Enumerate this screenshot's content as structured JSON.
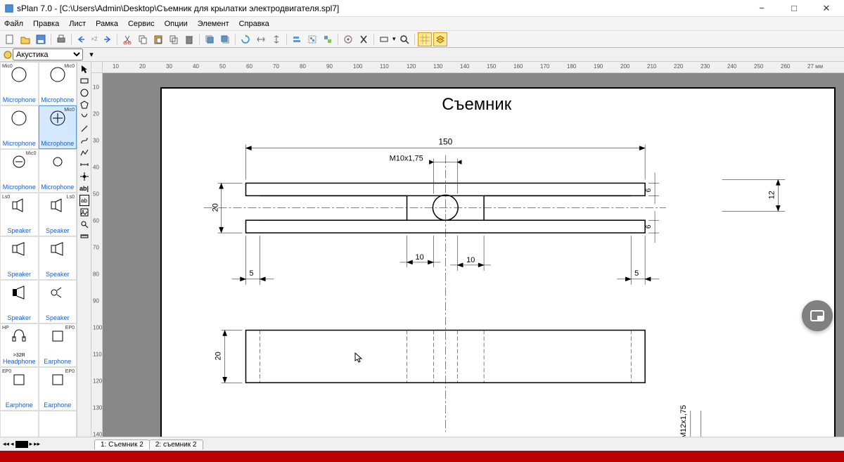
{
  "app": {
    "title": "sPlan 7.0 - [C:\\Users\\Admin\\Desktop\\Съемник для крылатки электродвигателя.spl7]"
  },
  "menu": [
    "Файл",
    "Правка",
    "Лист",
    "Рамка",
    "Сервис",
    "Опции",
    "Элемент",
    "Справка"
  ],
  "category": "Акустика",
  "palette": [
    {
      "l": "Microphone",
      "tag": "Mic0",
      "tl": "l"
    },
    {
      "l": "Microphone",
      "tag": "Mic0",
      "tl": "r"
    },
    {
      "l": "Microphone"
    },
    {
      "l": "Microphone",
      "tag": "Mic0",
      "tl": "r",
      "sel": true
    },
    {
      "l": "Microphone",
      "tag": "Mic0",
      "tl": "r"
    },
    {
      "l": "Microphone"
    },
    {
      "l": "Speaker",
      "tag": "Ls0",
      "tl": "l"
    },
    {
      "l": "Speaker",
      "tag": "Ls0",
      "tl": "r"
    },
    {
      "l": "Speaker"
    },
    {
      "l": "Speaker"
    },
    {
      "l": "Speaker"
    },
    {
      "l": "Speaker"
    },
    {
      "l": "Headphone",
      "tag": "HP",
      "tl": "l"
    },
    {
      "l": "Earphone",
      "tag": "EP0",
      "tl": "r"
    },
    {
      "l": "Earphone",
      "tag": "EP0",
      "tl": "l"
    },
    {
      "l": "Earphone",
      "tag": "EP0",
      "tl": "r"
    },
    {
      "l": ""
    },
    {
      "l": ""
    }
  ],
  "hp_sub": ">32R",
  "ruler_h": [
    "10",
    "20",
    "30",
    "40",
    "50",
    "60",
    "70",
    "80",
    "90",
    "100",
    "110",
    "120",
    "130",
    "140",
    "150",
    "160",
    "170",
    "180",
    "190",
    "200",
    "210",
    "220",
    "230",
    "240",
    "250",
    "260",
    "27 мм"
  ],
  "ruler_v": [
    "10",
    "20",
    "30",
    "40",
    "50",
    "60",
    "70",
    "80",
    "90",
    "100",
    "110",
    "120",
    "130",
    "140"
  ],
  "drawing": {
    "title": "Съемник",
    "dims": {
      "w150": "150",
      "thread": "M10x1,75",
      "h20a": "20",
      "h20b": "20",
      "d10a": "10",
      "d10b": "10",
      "d5a": "5",
      "d5b": "5",
      "d6a": "6",
      "d6b": "6",
      "d12": "12",
      "thread2": "M12x1,75"
    }
  },
  "tabs": [
    {
      "label": "1: Съемник 2",
      "active": true
    },
    {
      "label": "2: съемник 2"
    }
  ]
}
